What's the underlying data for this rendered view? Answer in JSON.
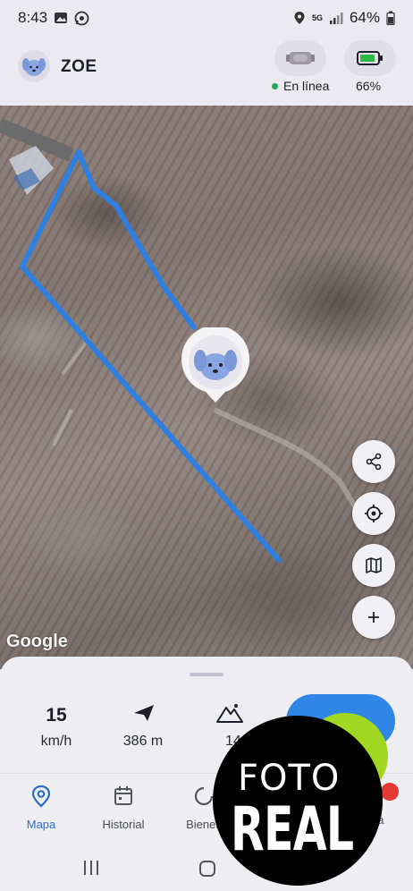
{
  "status_bar": {
    "time": "8:43",
    "network": "5G",
    "battery": "64%"
  },
  "header": {
    "pet_name": "ZOE",
    "online_label": "En línea",
    "battery_level": "66%",
    "online_color": "#27a35a"
  },
  "map": {
    "attribution": "Google",
    "route_color": "#2f7fe0",
    "fabs": [
      {
        "name": "share",
        "icon": "share-icon"
      },
      {
        "name": "locate",
        "icon": "crosshair-icon"
      },
      {
        "name": "map-layers",
        "icon": "map-icon"
      },
      {
        "name": "zoom-in",
        "icon": "plus-icon"
      }
    ]
  },
  "stats": {
    "speed_value": "15",
    "speed_unit": "km/h",
    "distance": "386 m",
    "altitude": "149"
  },
  "nav": {
    "items": [
      {
        "label": "Mapa",
        "icon": "location-pin-icon",
        "active": true
      },
      {
        "label": "Historial",
        "icon": "calendar-icon",
        "active": false
      },
      {
        "label": "Bienes",
        "icon": "activity-icon",
        "active": false
      },
      {
        "label": "ta",
        "icon": "more-icon",
        "active": false
      }
    ]
  },
  "overlay": {
    "line1": "FOTO",
    "line2": "REAL"
  },
  "colors": {
    "accent": "#2f86e6",
    "active_nav": "#2a6fc4",
    "badge_lime": "#a2d821"
  }
}
